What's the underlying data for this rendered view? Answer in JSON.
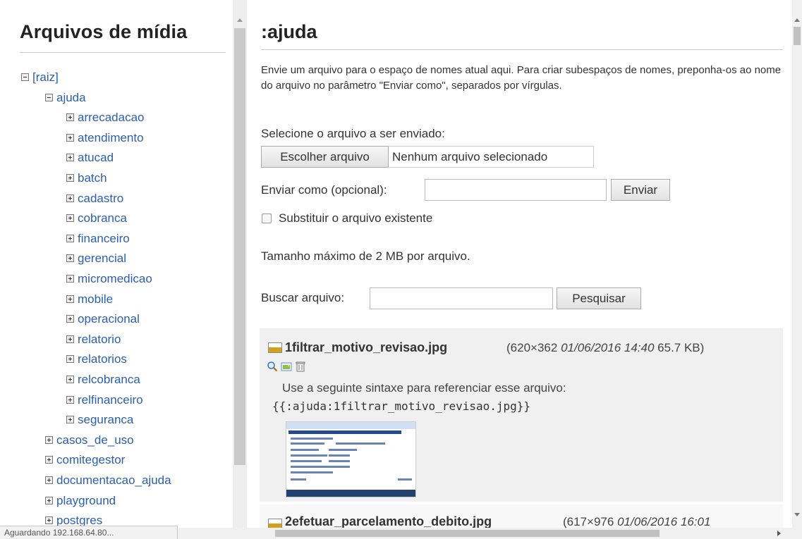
{
  "left_panel": {
    "title": "Arquivos de mídia",
    "tree": [
      {
        "label": "[raiz]",
        "expanded": true,
        "level": 0
      },
      {
        "label": "ajuda",
        "expanded": true,
        "level": 1
      },
      {
        "label": "arrecadacao",
        "expanded": false,
        "level": 2
      },
      {
        "label": "atendimento",
        "expanded": false,
        "level": 2
      },
      {
        "label": "atucad",
        "expanded": false,
        "level": 2
      },
      {
        "label": "batch",
        "expanded": false,
        "level": 2
      },
      {
        "label": "cadastro",
        "expanded": false,
        "level": 2
      },
      {
        "label": "cobranca",
        "expanded": false,
        "level": 2
      },
      {
        "label": "financeiro",
        "expanded": false,
        "level": 2
      },
      {
        "label": "gerencial",
        "expanded": false,
        "level": 2
      },
      {
        "label": "micromedicao",
        "expanded": false,
        "level": 2
      },
      {
        "label": "mobile",
        "expanded": false,
        "level": 2
      },
      {
        "label": "operacional",
        "expanded": false,
        "level": 2
      },
      {
        "label": "relatorio",
        "expanded": false,
        "level": 2
      },
      {
        "label": "relatorios",
        "expanded": false,
        "level": 2
      },
      {
        "label": "relcobranca",
        "expanded": false,
        "level": 2
      },
      {
        "label": "relfinanceiro",
        "expanded": false,
        "level": 2
      },
      {
        "label": "seguranca",
        "expanded": false,
        "level": 2
      },
      {
        "label": "casos_de_uso",
        "expanded": false,
        "level": 1
      },
      {
        "label": "comitegestor",
        "expanded": false,
        "level": 1
      },
      {
        "label": "documentacao_ajuda",
        "expanded": false,
        "level": 1
      },
      {
        "label": "playground",
        "expanded": false,
        "level": 1
      },
      {
        "label": "postgres",
        "expanded": false,
        "level": 1
      }
    ]
  },
  "main": {
    "title": ":ajuda",
    "intro": "Envie um arquivo para o espaço de nomes atual aqui. Para criar subespaços de nomes, preponha-os ao nome do arquivo no parâmetro \"Enviar como\", separados por vírgulas.",
    "upload": {
      "select_label": "Selecione o arquivo a ser enviado:",
      "choose_button": "Escolher arquivo",
      "choose_status": "Nenhum arquivo selecionado",
      "send_as_label": "Enviar como (opcional):",
      "send_as_value": "",
      "send_button": "Enviar",
      "replace_label": "Substituir o arquivo existente",
      "replace_checked": false,
      "max_size": "Tamanho máximo de 2 MB por arquivo."
    },
    "search": {
      "label": "Buscar arquivo:",
      "value": "",
      "button": "Pesquisar"
    },
    "files": [
      {
        "name": "1filtrar_motivo_revisao.jpg",
        "dims": "(620×362",
        "date": "01/06/2016 14:40",
        "size": "65.7 KB)",
        "syntax_label": "Use a seguinte sintaxe para referenciar esse arquivo:",
        "syntax": "{{:ajuda:1filtrar_motivo_revisao.jpg}}"
      },
      {
        "name": "2efetuar_parcelamento_debito.jpg",
        "dims": "(617×976",
        "date": "01/06/2016 16:01"
      }
    ]
  },
  "status_bar": {
    "text": "Aguardando 192.168.64.80..."
  },
  "colors": {
    "link": "#2b5fad",
    "file_box": "#f0f0f0"
  }
}
